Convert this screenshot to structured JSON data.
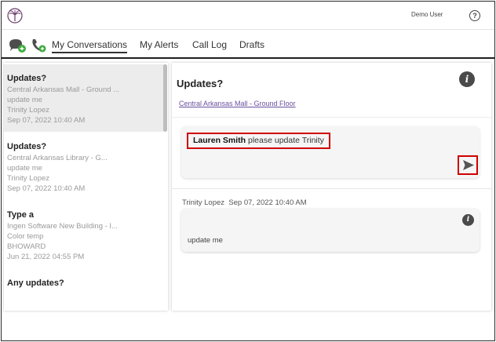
{
  "header": {
    "user_name": "Demo User",
    "help_symbol": "?",
    "logo_icon": "palm-tree-logo",
    "help_icon": "help-circle-icon"
  },
  "nav": {
    "icons": [
      "chat-add-icon",
      "phone-add-icon"
    ],
    "tabs": [
      {
        "label": "My Conversations",
        "active": true
      },
      {
        "label": "My Alerts",
        "active": false
      },
      {
        "label": "Call Log",
        "active": false
      },
      {
        "label": "Drafts",
        "active": false
      }
    ]
  },
  "conversations": [
    {
      "title": "Updates?",
      "location": "Central Arkansas Mall - Ground ...",
      "last_message": "update me",
      "author": "Trinity Lopez",
      "timestamp": "Sep 07, 2022 10:40 AM",
      "selected": true
    },
    {
      "title": "Updates?",
      "location": "Central Arkansas  Library - G...",
      "last_message": "update me",
      "author": "Trinity Lopez",
      "timestamp": "Sep 07, 2022 10:40 AM",
      "selected": false
    },
    {
      "title": "Type a",
      "location": "Ingen Software New Building - I...",
      "last_message": "Color temp",
      "author": "BHOWARD",
      "timestamp": "Jun 21, 2022 04:55 PM",
      "selected": false
    },
    {
      "title": "Any updates?",
      "location": "",
      "last_message": "",
      "author": "",
      "timestamp": "",
      "selected": false
    }
  ],
  "detail": {
    "title": "Updates?",
    "info_symbol": "i",
    "location_link": "Central Arkansas Mall - Ground Floor",
    "compose": {
      "mention": "Lauren Smith",
      "text": " please update Trinity",
      "send_icon": "send-arrow-icon"
    },
    "messages": [
      {
        "author": "Trinity Lopez",
        "timestamp": "Sep 07, 2022 10:40 AM",
        "body": "update me",
        "info_symbol": "i"
      }
    ]
  },
  "colors": {
    "link": "#6a4fa0",
    "highlight_border": "#d00000",
    "selected_row": "#ececec",
    "green_badge": "#3daa3d",
    "info_icon": "#4a4a4a"
  }
}
